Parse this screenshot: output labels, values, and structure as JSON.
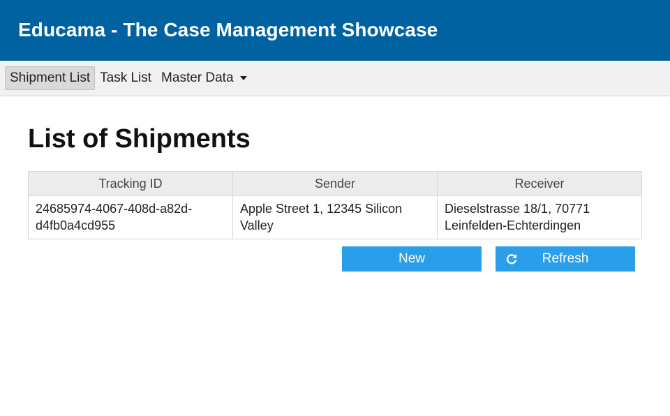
{
  "header": {
    "title": "Educama - The Case Management Showcase"
  },
  "menu": {
    "items": [
      {
        "label": "Shipment List",
        "active": true
      },
      {
        "label": "Task List"
      },
      {
        "label": "Master Data",
        "dropdown": true
      }
    ]
  },
  "page": {
    "title": "List of Shipments"
  },
  "table": {
    "columns": [
      "Tracking ID",
      "Sender",
      "Receiver"
    ],
    "rows": [
      {
        "tracking_id": "24685974-4067-408d-a82d-d4fb0a4cd955",
        "sender": "Apple Street 1, 12345 Silicon Valley",
        "receiver": "Dieselstrasse 18/1, 70771 Leinfelden-Echterdingen"
      }
    ]
  },
  "actions": {
    "new_label": "New",
    "refresh_label": "Refresh",
    "refresh_icon": "refresh-icon",
    "button_color": "#2a9ee8"
  },
  "colors": {
    "header_bg": "#0062a0",
    "menubar_bg": "#f1f1f1"
  }
}
